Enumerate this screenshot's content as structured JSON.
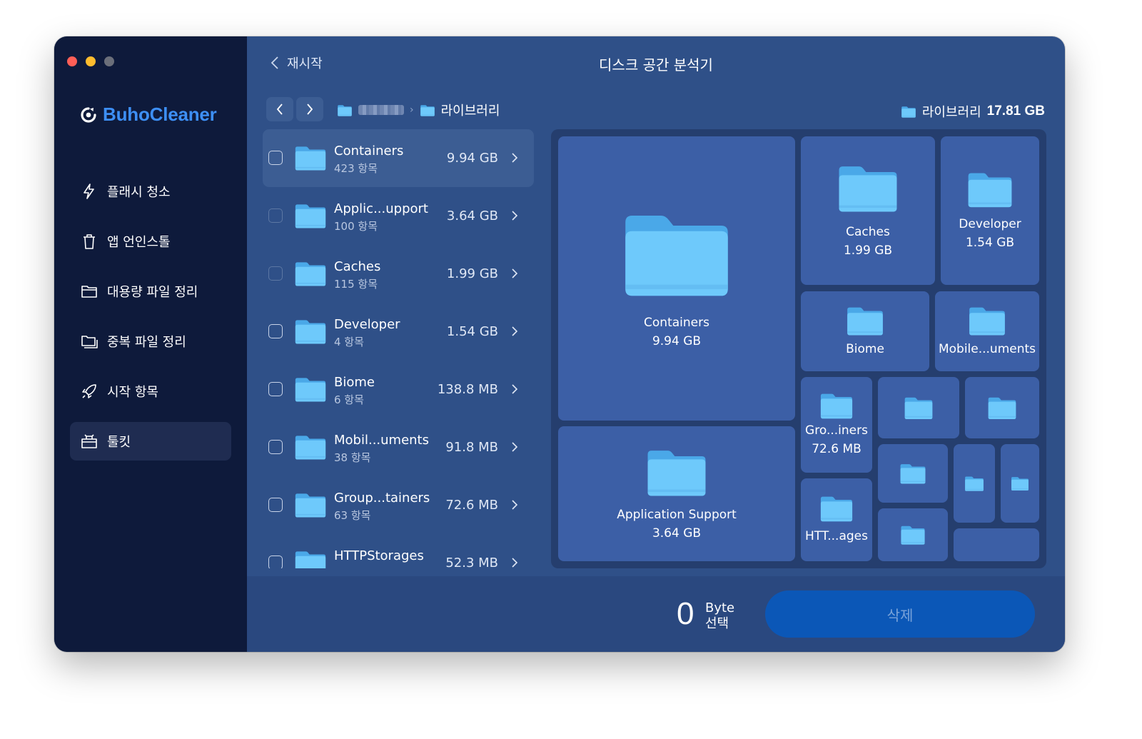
{
  "window": {
    "traffic_lights": [
      "#ff5f57",
      "#febc2e",
      "#6b6f7a"
    ]
  },
  "colors": {
    "brand": "#3d8ff5",
    "sidebar_bg": "#0e1a3b",
    "main_bg": "#2f5088",
    "folder": "#6ec9fb",
    "delete_button": "#0b57b7"
  },
  "app": {
    "name": "BuhoCleaner",
    "logo_icon": "buho-logo-icon"
  },
  "sidebar": {
    "items": [
      {
        "label": "플래시 청소",
        "icon": "lightning-icon",
        "active": false
      },
      {
        "label": "앱 언인스톨",
        "icon": "trash-icon",
        "active": false
      },
      {
        "label": "대용량 파일 정리",
        "icon": "folder-icon",
        "active": false
      },
      {
        "label": "중복 파일 정리",
        "icon": "duplicate-folder-icon",
        "active": false
      },
      {
        "label": "시작 항목",
        "icon": "rocket-icon",
        "active": false
      },
      {
        "label": "툴킷",
        "icon": "toolbox-icon",
        "active": true
      }
    ]
  },
  "header": {
    "back_label": "재시작",
    "title": "디스크 공간 분석기"
  },
  "breadcrumb": {
    "current": "라이브러리",
    "separator": "›"
  },
  "summary": {
    "folder": "라이브러리",
    "size": "17.81 GB"
  },
  "list": {
    "rows": [
      {
        "name": "Containers",
        "count": "423 항목",
        "size": "9.94 GB",
        "selected": true
      },
      {
        "name": "Applic...upport",
        "count": "100 항목",
        "size": "3.64 GB"
      },
      {
        "name": "Caches",
        "count": "115 항목",
        "size": "1.99 GB"
      },
      {
        "name": "Developer",
        "count": "4 항목",
        "size": "1.54 GB"
      },
      {
        "name": "Biome",
        "count": "6 항목",
        "size": "138.8 MB"
      },
      {
        "name": "Mobil...uments",
        "count": "38 항목",
        "size": "91.8 MB"
      },
      {
        "name": "Group...tainers",
        "count": "63 항목",
        "size": "72.6 MB"
      },
      {
        "name": "HTTPStorages",
        "count": "",
        "size": "52.3 MB"
      }
    ]
  },
  "treemap": {
    "containers": {
      "name": "Containers",
      "size": "9.94 GB"
    },
    "app_support": {
      "name": "Application Support",
      "size": "3.64 GB"
    },
    "caches": {
      "name": "Caches",
      "size": "1.99 GB"
    },
    "developer": {
      "name": "Developer",
      "size": "1.54 GB"
    },
    "biome": {
      "name": "Biome"
    },
    "mobile": {
      "name": "Mobile...uments"
    },
    "group": {
      "name": "Gro...iners",
      "size": "72.6 MB"
    },
    "http": {
      "name": "HTT...ages"
    }
  },
  "bottom": {
    "selected_value": "0",
    "selected_unit": "Byte",
    "selected_label": "선택",
    "delete_label": "삭제"
  }
}
